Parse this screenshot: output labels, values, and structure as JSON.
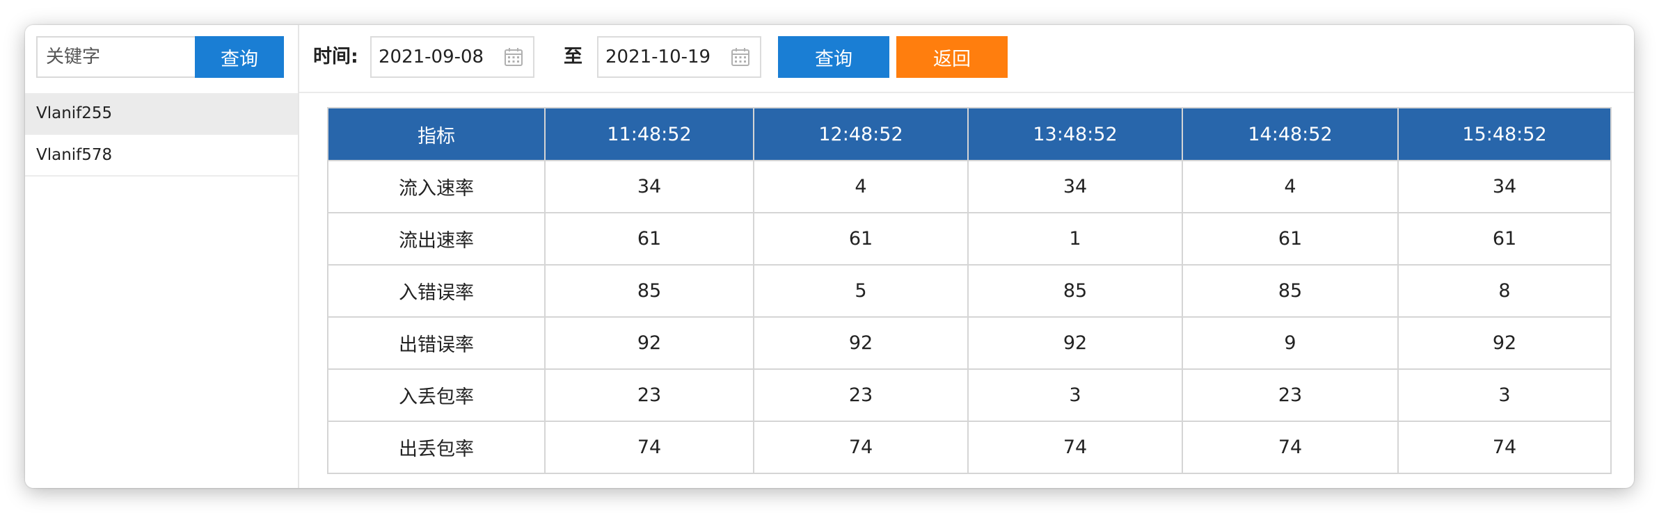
{
  "sidebar": {
    "search": {
      "placeholder": "关键字",
      "button_label": "查询"
    },
    "items": [
      {
        "label": "Vlanif255",
        "active": true
      },
      {
        "label": "Vlanif578",
        "active": false
      }
    ]
  },
  "toolbar": {
    "time_label": "时间:",
    "start_date": "2021-09-08",
    "to_label": "至",
    "end_date": "2021-10-19",
    "query_label": "查询",
    "back_label": "返回"
  },
  "table": {
    "headers": [
      "指标",
      "11:48:52",
      "12:48:52",
      "13:48:52",
      "14:48:52",
      "15:48:52"
    ],
    "rows": [
      [
        "流入速率",
        "34",
        "4",
        "34",
        "4",
        "34"
      ],
      [
        "流出速率",
        "61",
        "61",
        "1",
        "61",
        "61"
      ],
      [
        "入错误率",
        "85",
        "5",
        "85",
        "85",
        "8"
      ],
      [
        "出错误率",
        "92",
        "92",
        "92",
        "9",
        "92"
      ],
      [
        "入丢包率",
        "23",
        "23",
        "3",
        "23",
        "3"
      ],
      [
        "出丢包率",
        "74",
        "74",
        "74",
        "74",
        "74"
      ]
    ]
  },
  "colors": {
    "primary_button": "#1a7ed4",
    "back_button": "#ff7e0e",
    "table_header": "#2866ab",
    "active_item": "#ebebeb"
  },
  "icons": {
    "date_picker": "calendar-icon"
  }
}
